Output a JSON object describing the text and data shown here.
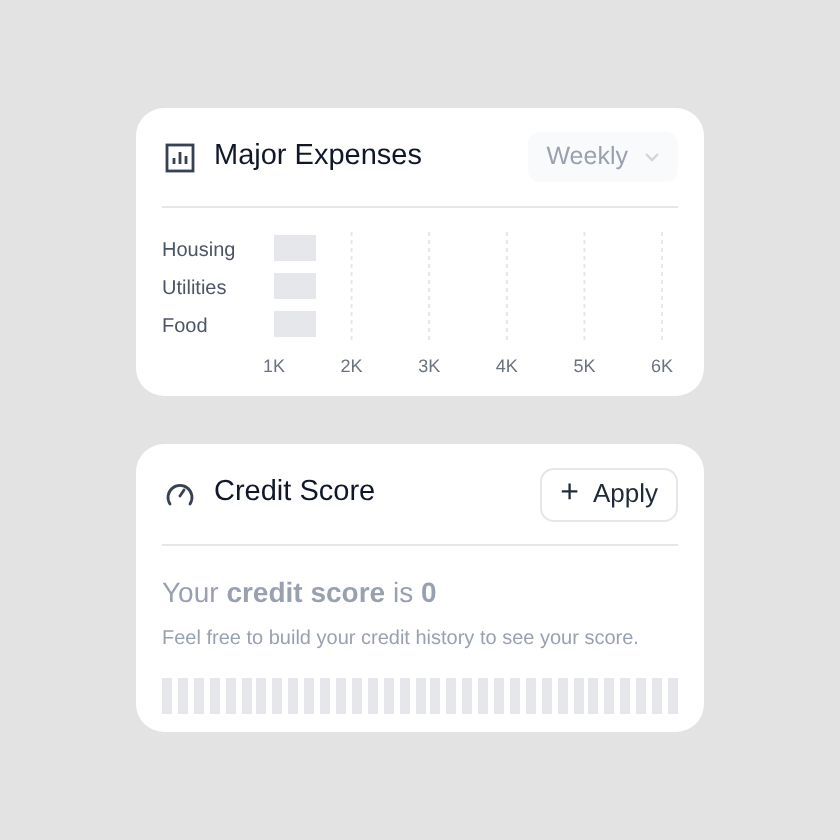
{
  "expenses_card": {
    "title": "Major Expenses",
    "period_dropdown": {
      "value": "Weekly",
      "disabled": true
    },
    "chart": {
      "categories": [
        "Housing",
        "Utilities",
        "Food"
      ],
      "tick_labels": [
        "1K",
        "2K",
        "3K",
        "4K",
        "5K",
        "6K"
      ]
    }
  },
  "credit_card": {
    "title": "Credit Score",
    "apply_button": {
      "icon": "+",
      "label": "Apply"
    },
    "score_line": "Your **credit score** is **0**",
    "hint": "Feel free to build your credit history to see your score."
  }
}
